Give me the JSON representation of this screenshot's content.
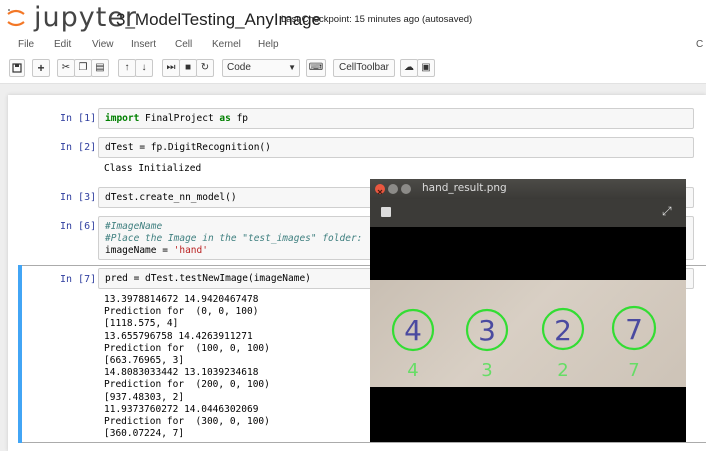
{
  "header": {
    "brand": "jupyter",
    "notebook_name": "3_ModelTesting_AnyImage",
    "checkpoint": "Last Checkpoint: 15 minutes ago (autosaved)"
  },
  "menu": {
    "items": [
      "File",
      "Edit",
      "View",
      "Insert",
      "Cell",
      "Kernel",
      "Help"
    ],
    "right_char": "C"
  },
  "toolbar": {
    "cell_type": "Code",
    "celltoolbar_label": "CellToolbar",
    "icons": [
      "save-icon",
      "plus-icon",
      "scissors-icon",
      "copy-icon",
      "paste-icon",
      "arrow-up-icon",
      "arrow-down-icon",
      "run-icon",
      "stop-icon",
      "restart-icon",
      "keyboard-icon",
      "cloud-icon",
      "present-icon"
    ]
  },
  "cells": {
    "c1": {
      "prompt": "In [1]:",
      "kw1": "import",
      "mod": " FinalProject ",
      "kw2": "as",
      "alias": " fp"
    },
    "c2": {
      "prompt": "In [2]:",
      "code": "dTest = fp.DigitRecognition()",
      "output": "Class Initialized"
    },
    "c3": {
      "prompt": "In [3]:",
      "code": "dTest.create_nn_model()"
    },
    "c4": {
      "prompt": "In [6]:",
      "comment1": "#ImageName",
      "comment2": "#Place the Image in the \"test_images\" folder:",
      "assign": "imageName = ",
      "str": "'hand'"
    },
    "c5": {
      "prompt": "In [7]:",
      "code": "pred = dTest.testNewImage(imageName)",
      "output": [
        "13.3978814672 14.9420467478",
        "Prediction for  (0, 0, 100)",
        "[1118.575, 4]",
        "13.655796758 14.4263911271",
        "Prediction for  (100, 0, 100)",
        "[663.76965, 3]",
        "14.8083033442 13.1039234618",
        "Prediction for  (200, 0, 100)",
        "[937.48303, 2]",
        "11.9373760272 14.0446302069",
        "Prediction for  (300, 0, 100)",
        "[360.07224, 7]"
      ]
    }
  },
  "image_window": {
    "title": "hand_result.png",
    "detected_digits": [
      "4",
      "3",
      "2",
      "7"
    ],
    "written_digits": [
      "4",
      "3",
      "2",
      "7"
    ],
    "circle_color": "#33dd33"
  },
  "colors": {
    "prompt": "#303f9f",
    "selected": "#42a5f5",
    "keyword": "#008000",
    "string": "#ba2121"
  }
}
